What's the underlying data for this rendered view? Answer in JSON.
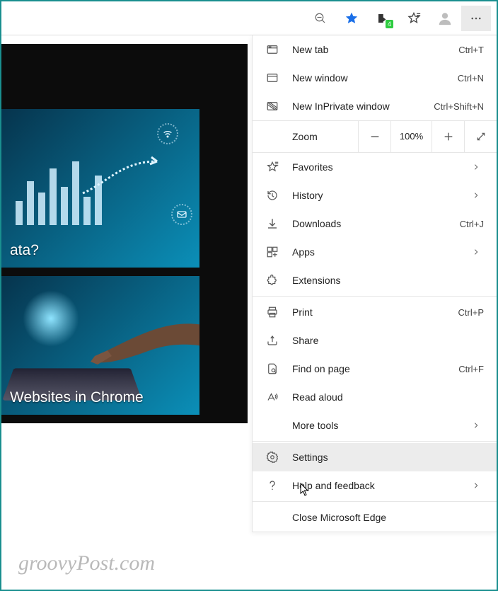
{
  "toolbar": {
    "ext_badge": "4"
  },
  "cards": {
    "card1_title": "ata?",
    "card2_title": "Websites in Chrome"
  },
  "watermark": "groovyPost.com",
  "menu": {
    "new_tab": {
      "label": "New tab",
      "shortcut": "Ctrl+T"
    },
    "new_window": {
      "label": "New window",
      "shortcut": "Ctrl+N"
    },
    "new_inprivate": {
      "label": "New InPrivate window",
      "shortcut": "Ctrl+Shift+N"
    },
    "zoom": {
      "label": "Zoom",
      "value": "100%"
    },
    "favorites": {
      "label": "Favorites"
    },
    "history": {
      "label": "History"
    },
    "downloads": {
      "label": "Downloads",
      "shortcut": "Ctrl+J"
    },
    "apps": {
      "label": "Apps"
    },
    "extensions": {
      "label": "Extensions"
    },
    "print": {
      "label": "Print",
      "shortcut": "Ctrl+P"
    },
    "share": {
      "label": "Share"
    },
    "find": {
      "label": "Find on page",
      "shortcut": "Ctrl+F"
    },
    "read_aloud": {
      "label": "Read aloud"
    },
    "more_tools": {
      "label": "More tools"
    },
    "settings": {
      "label": "Settings"
    },
    "help": {
      "label": "Help and feedback"
    },
    "close": {
      "label": "Close Microsoft Edge"
    }
  }
}
